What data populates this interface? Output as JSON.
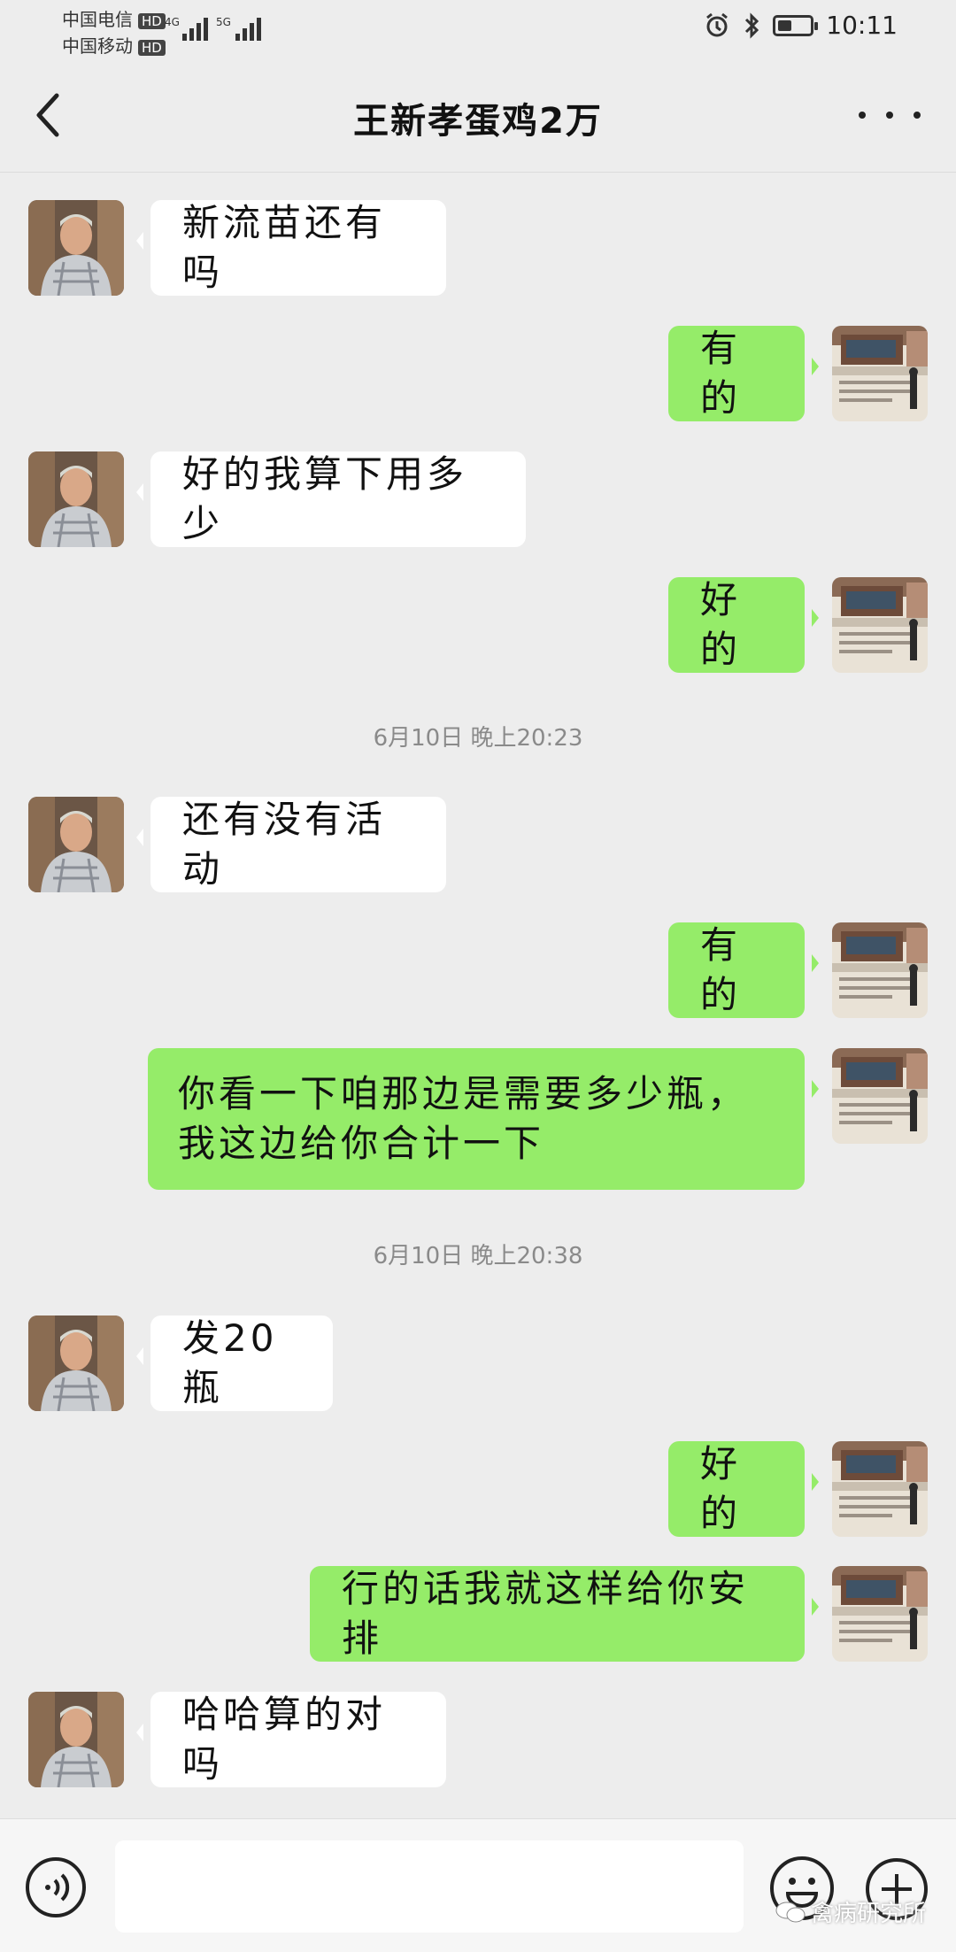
{
  "status_bar": {
    "carrier1": "中国电信",
    "carrier2": "中国移动",
    "hd": "HD",
    "net1": "4G",
    "net2": "5G",
    "time": "10:11",
    "battery_level": 0.45
  },
  "header": {
    "title": "王新孝蛋鸡2万"
  },
  "messages": [
    {
      "side": "left",
      "text": "新流苗还有吗"
    },
    {
      "side": "right",
      "text": "有的"
    },
    {
      "side": "left",
      "text": "好的我算下用多少"
    },
    {
      "side": "right",
      "text": "好的"
    },
    {
      "timestamp": "6月10日 晚上20:23"
    },
    {
      "side": "left",
      "text": "还有没有活动"
    },
    {
      "side": "right",
      "text": "有的"
    },
    {
      "side": "right",
      "text": "你看一下咱那边是需要多少瓶，我这边给你合计一下"
    },
    {
      "timestamp": "6月10日 晚上20:38"
    },
    {
      "side": "left",
      "text": "发20瓶"
    },
    {
      "side": "right",
      "text": "好的"
    },
    {
      "side": "right",
      "text": "行的话我就这样给你安排"
    },
    {
      "side": "left",
      "text": "哈哈算的对吗"
    }
  ],
  "input": {
    "value": "",
    "placeholder": ""
  },
  "watermark": "禽病研究所",
  "icons": {
    "back": "chevron-left-icon",
    "more": "more-dots-icon",
    "voice": "voice-icon",
    "emoji": "emoji-icon",
    "plus": "plus-icon"
  },
  "colors": {
    "background": "#ededed",
    "bubble_self": "#95ec69",
    "bubble_other": "#ffffff"
  }
}
